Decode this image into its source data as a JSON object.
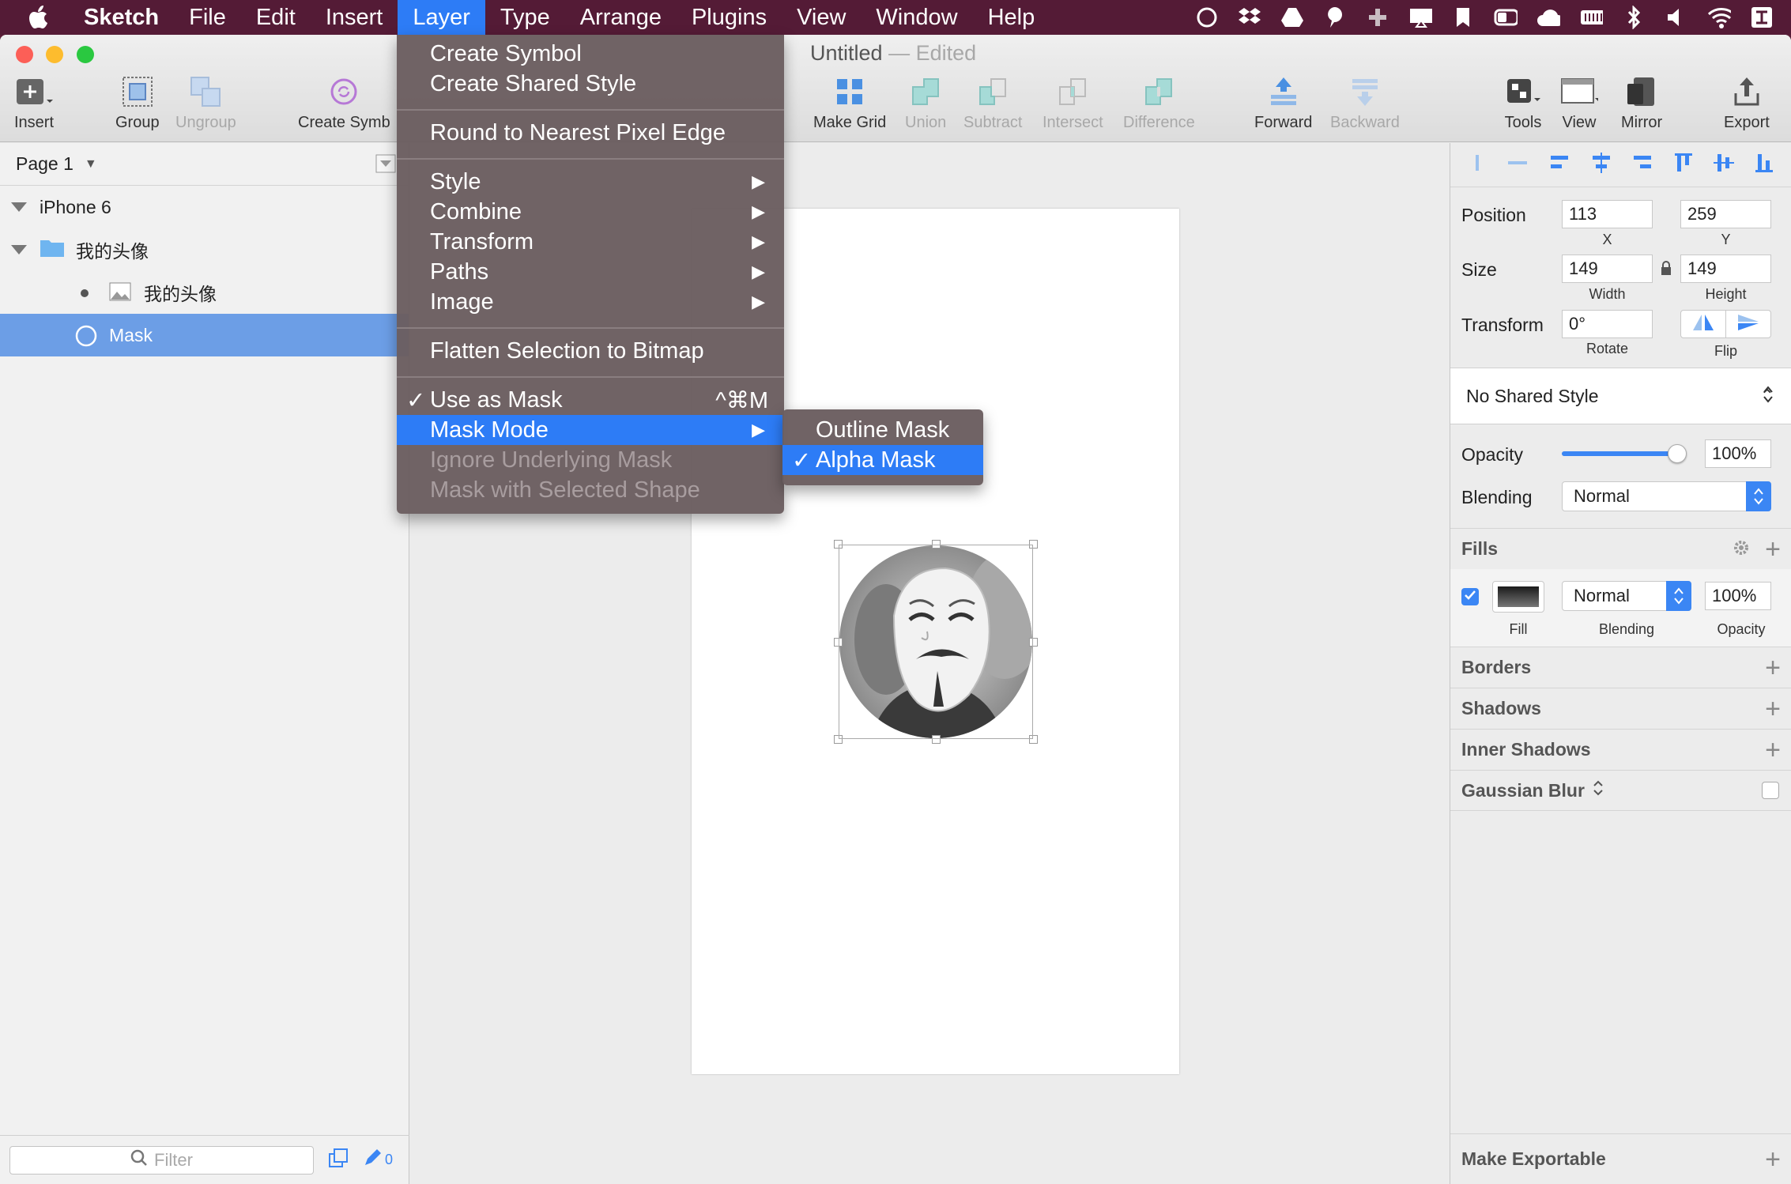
{
  "menubar": {
    "app_name": "Sketch",
    "items": [
      "File",
      "Edit",
      "Insert",
      "Layer",
      "Type",
      "Arrange",
      "Plugins",
      "View",
      "Window",
      "Help"
    ]
  },
  "window": {
    "title": "Untitled",
    "title_sep": "—",
    "title_state": "Edited"
  },
  "toolbar": {
    "insert": "Insert",
    "group": "Group",
    "ungroup": "Ungroup",
    "create_symbol": "Create Symb",
    "make_grid": "Make Grid",
    "union": "Union",
    "subtract": "Subtract",
    "intersect": "Intersect",
    "difference": "Difference",
    "forward": "Forward",
    "backward": "Backward",
    "tools": "Tools",
    "view": "View",
    "mirror": "Mirror",
    "export": "Export"
  },
  "layers": {
    "page": "Page 1",
    "artboard": "iPhone 6",
    "group": "我的头像",
    "image": "我的头像",
    "mask": "Mask",
    "filter_placeholder": "Filter",
    "edit_count": "0"
  },
  "menu": {
    "create_symbol": "Create Symbol",
    "create_shared_style": "Create Shared Style",
    "round_pixel": "Round to Nearest Pixel Edge",
    "style": "Style",
    "combine": "Combine",
    "transform": "Transform",
    "paths": "Paths",
    "image": "Image",
    "flatten": "Flatten Selection to Bitmap",
    "use_as_mask": "Use as Mask",
    "use_as_mask_shortcut": "^⌘M",
    "mask_mode": "Mask Mode",
    "ignore_underlying": "Ignore Underlying Mask",
    "mask_selected": "Mask with Selected Shape"
  },
  "submenu": {
    "outline_mask": "Outline Mask",
    "alpha_mask": "Alpha Mask"
  },
  "inspector": {
    "position_label": "Position",
    "x_value": "113",
    "y_value": "259",
    "x_label": "X",
    "y_label": "Y",
    "size_label": "Size",
    "width_value": "149",
    "height_value": "149",
    "width_label": "Width",
    "height_label": "Height",
    "transform_label": "Transform",
    "rotate_value": "0°",
    "rotate_label": "Rotate",
    "flip_label": "Flip",
    "shared_style": "No Shared Style",
    "opacity_label": "Opacity",
    "opacity_value": "100%",
    "opacity_level": 1.0,
    "blending_label": "Blending",
    "blending_value": "Normal",
    "fills_label": "Fills",
    "fill_blending": "Normal",
    "fill_opacity": "100%",
    "fill_col_fill": "Fill",
    "fill_col_blending": "Blending",
    "fill_col_opacity": "Opacity",
    "borders": "Borders",
    "shadows": "Shadows",
    "inner_shadows": "Inner Shadows",
    "gaussian_blur": "Gaussian Blur",
    "make_exportable": "Make Exportable"
  },
  "colors": {
    "accent": "#2d7cf6",
    "selection": "#6c9ee6",
    "menubar": "#541b36"
  }
}
